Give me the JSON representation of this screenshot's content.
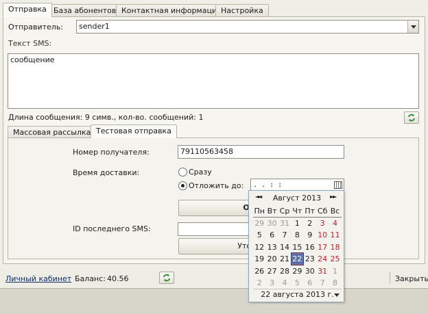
{
  "tabs": [
    "Отправка",
    "База абонентов",
    "Контактная информация",
    "Настройка"
  ],
  "sender": {
    "label": "Отправитель:",
    "value": "sender1"
  },
  "sms_text": {
    "label": "Текст SMS:",
    "value": "сообщение"
  },
  "length_info": "Длина сообщения: 9 симв., кол-во. сообщений: 1",
  "subtabs": [
    "Массовая рассылка",
    "Тестовая отправка"
  ],
  "test": {
    "recipient_label": "Номер получателя:",
    "recipient_value": "79110563458",
    "delivery_label": "Время доставки:",
    "option_now": "Сразу",
    "option_defer": "Отложить до:",
    "defer_value": "  .  .    :  :  ",
    "send_button": "Отправи",
    "last_id_label": "ID последнего SMS:",
    "last_id_value": "",
    "check_button": "Уточнить ст"
  },
  "calendar": {
    "month": "Август 2013",
    "prev_symbol": "◄◄",
    "next_symbol": "►►",
    "weekdays": [
      "Пн",
      "Вт",
      "Ср",
      "Чт",
      "Пт",
      "Сб",
      "Вс"
    ],
    "weeks": [
      [
        "29",
        "30",
        "31",
        "1",
        "2",
        "3",
        "4"
      ],
      [
        "5",
        "6",
        "7",
        "8",
        "9",
        "10",
        "11"
      ],
      [
        "12",
        "13",
        "14",
        "15",
        "16",
        "17",
        "18"
      ],
      [
        "19",
        "20",
        "21",
        "22",
        "23",
        "24",
        "25"
      ],
      [
        "26",
        "27",
        "28",
        "29",
        "30",
        "31",
        "1"
      ],
      [
        "2",
        "3",
        "4",
        "5",
        "6",
        "7",
        "8"
      ]
    ],
    "selected": "22",
    "footer": "22 августа 2013 г."
  },
  "status": {
    "cabinet_link": "Личный кабинет",
    "balance_label": "Баланс:",
    "balance_value": "40.56",
    "close_link": "Закрыть"
  },
  "icons": {
    "refresh": "refresh-icon",
    "calendar": "calendar-icon",
    "dropdown": "chevron-down-icon"
  },
  "colors": {
    "selected_day": "#5b6fa8",
    "weekend": "#c0202a",
    "link": "#0b2a66"
  }
}
